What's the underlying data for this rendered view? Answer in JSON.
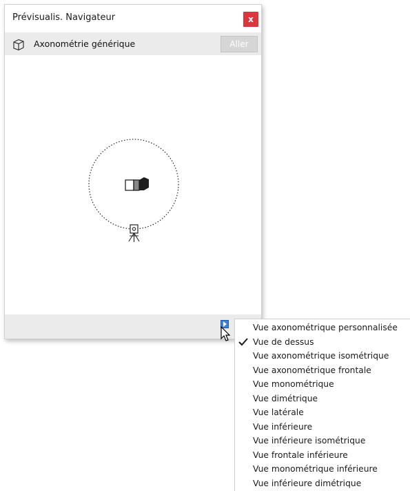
{
  "window": {
    "title": "Prévisualis. Navigateur",
    "close_label": "x"
  },
  "viewbar": {
    "view_name": "Axonométrie générique",
    "go_label": "Aller"
  },
  "menu": {
    "items": [
      {
        "label": "Vue axonométrique personnalisée",
        "checked": false
      },
      {
        "label": "Vue de dessus",
        "checked": true
      },
      {
        "label": "Vue axonométrique isométrique",
        "checked": false
      },
      {
        "label": "Vue axonométrique frontale",
        "checked": false
      },
      {
        "label": "Vue monométrique",
        "checked": false
      },
      {
        "label": "Vue dimétrique",
        "checked": false
      },
      {
        "label": "Vue latérale",
        "checked": false
      },
      {
        "label": "Vue inférieure",
        "checked": false
      },
      {
        "label": "Vue inférieure isométrique",
        "checked": false
      },
      {
        "label": "Vue frontale inférieure",
        "checked": false
      },
      {
        "label": "Vue monométrique inférieure",
        "checked": false
      },
      {
        "label": "Vue inférieure dimétrique",
        "checked": false
      }
    ]
  },
  "colors": {
    "close_button": "#d9363e",
    "menu_button": "#3d7fd8",
    "bar_background": "#ebebeb"
  }
}
